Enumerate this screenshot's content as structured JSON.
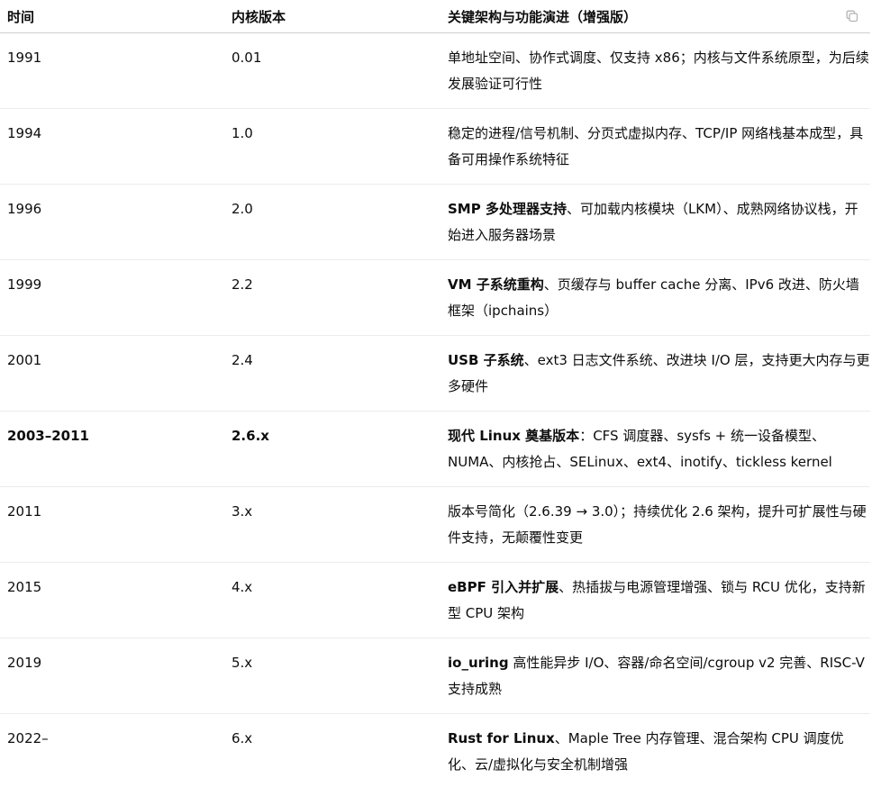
{
  "table": {
    "headers": {
      "time": "时间",
      "version": "内核版本",
      "features": "关键架构与功能演进（增强版）"
    },
    "rows": [
      {
        "time": "1991",
        "version": "0.01",
        "lead": "",
        "rest": "单地址空间、协作式调度、仅支持 x86；内核与文件系统原型，为后续发展验证可行性"
      },
      {
        "time": "1994",
        "version": "1.0",
        "lead": "",
        "rest": "稳定的进程/信号机制、分页式虚拟内存、TCP/IP 网络栈基本成型，具备可用操作系统特征"
      },
      {
        "time": "1996",
        "version": "2.0",
        "lead": "SMP 多处理器支持",
        "rest": "、可加载内核模块（LKM）、成熟网络协议栈，开始进入服务器场景"
      },
      {
        "time": "1999",
        "version": "2.2",
        "lead": "VM 子系统重构",
        "rest": "、页缓存与 buffer cache 分离、IPv6 改进、防火墙框架（ipchains）"
      },
      {
        "time": "2001",
        "version": "2.4",
        "lead": "USB 子系统",
        "rest": "、ext3 日志文件系统、改进块 I/O 层，支持更大内存与更多硬件"
      },
      {
        "time": "2003–2011",
        "version": "2.6.x",
        "lead": "现代 Linux 奠基版本",
        "rest": "：CFS 调度器、sysfs + 统一设备模型、NUMA、内核抢占、SELinux、ext4、inotify、tickless kernel"
      },
      {
        "time": "2011",
        "version": "3.x",
        "lead": "",
        "rest": "版本号简化（2.6.39 → 3.0）；持续优化 2.6 架构，提升可扩展性与硬件支持，无颠覆性变更"
      },
      {
        "time": "2015",
        "version": "4.x",
        "lead": "eBPF 引入并扩展",
        "rest": "、热插拔与电源管理增强、锁与 RCU 优化，支持新型 CPU 架构"
      },
      {
        "time": "2019",
        "version": "5.x",
        "lead": "io_uring",
        "rest": " 高性能异步 I/O、容器/命名空间/cgroup v2 完善、RISC-V 支持成熟"
      },
      {
        "time": "2022–",
        "version": "6.x",
        "lead": "Rust for Linux",
        "rest": "、Maple Tree 内存管理、混合架构 CPU 调度优化、云/虚拟化与安全机制增强"
      }
    ]
  },
  "icons": {
    "copy": "copy-icon"
  }
}
